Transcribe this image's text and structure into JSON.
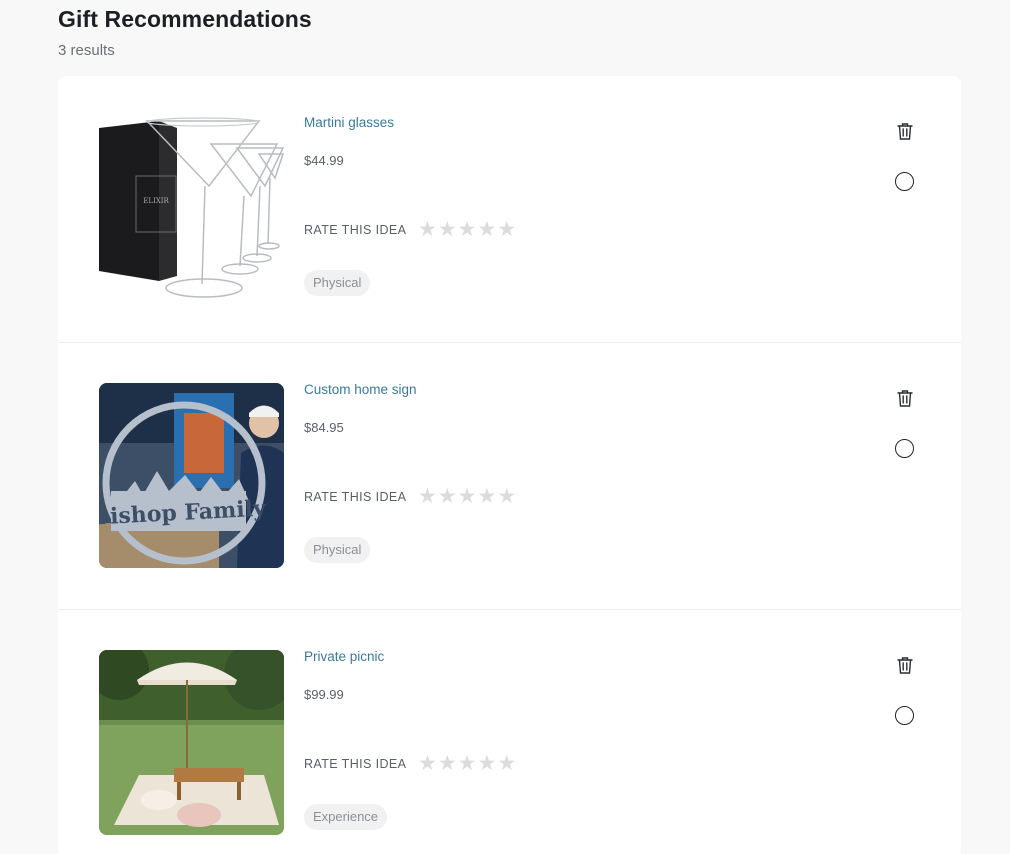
{
  "header": {
    "title": "Gift Recommendations",
    "result_count": "3 results"
  },
  "rate_label": "RATE THIS IDEA",
  "items": [
    {
      "name": "Martini glasses",
      "price": "$44.99",
      "rating": 0,
      "tag": "Physical",
      "image_icon": "martini-glasses-photo",
      "box_text": "ELIXIR"
    },
    {
      "name": "Custom home sign",
      "price": "$84.95",
      "rating": 0,
      "tag": "Physical",
      "image_icon": "custom-sign-photo",
      "sign_text": "Bishop Family"
    },
    {
      "name": "Private picnic",
      "price": "$99.99",
      "rating": 0,
      "tag": "Experience",
      "image_icon": "picnic-photo"
    }
  ]
}
